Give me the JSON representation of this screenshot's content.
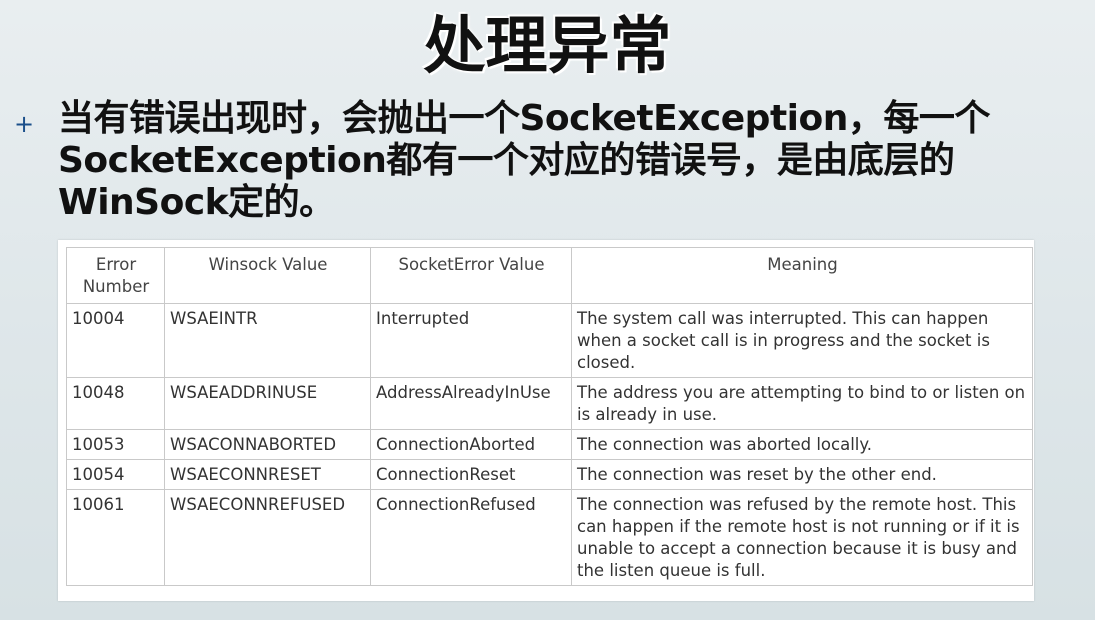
{
  "slide": {
    "title": "处理异常",
    "bullet_mark": "+",
    "bullet_text": "当有错误出现时，会抛出一个SocketException，每一个SocketException都有一个对应的错误号，是由底层的WinSock定的。"
  },
  "table": {
    "headers": [
      "Error Number",
      "Winsock Value",
      "SocketError Value",
      "Meaning"
    ],
    "rows": [
      [
        "10004",
        "WSAEINTR",
        "Interrupted",
        "The system call was interrupted. This can happen when a socket call is in progress and the socket is closed."
      ],
      [
        "10048",
        "WSAEADDRINUSE",
        "AddressAlreadyInUse",
        "The address you are attempting to bind to or listen on is already in use."
      ],
      [
        "10053",
        "WSACONNABORTED",
        "ConnectionAborted",
        "The connection was aborted locally."
      ],
      [
        "10054",
        "WSAECONNRESET",
        "ConnectionReset",
        "The connection was reset by the other end."
      ],
      [
        "10061",
        "WSAECONNREFUSED",
        "ConnectionRefused",
        "The connection was refused by the remote host. This can happen if the remote host is not running or if it is unable to accept a connection because it is busy and the listen queue is full."
      ]
    ]
  }
}
